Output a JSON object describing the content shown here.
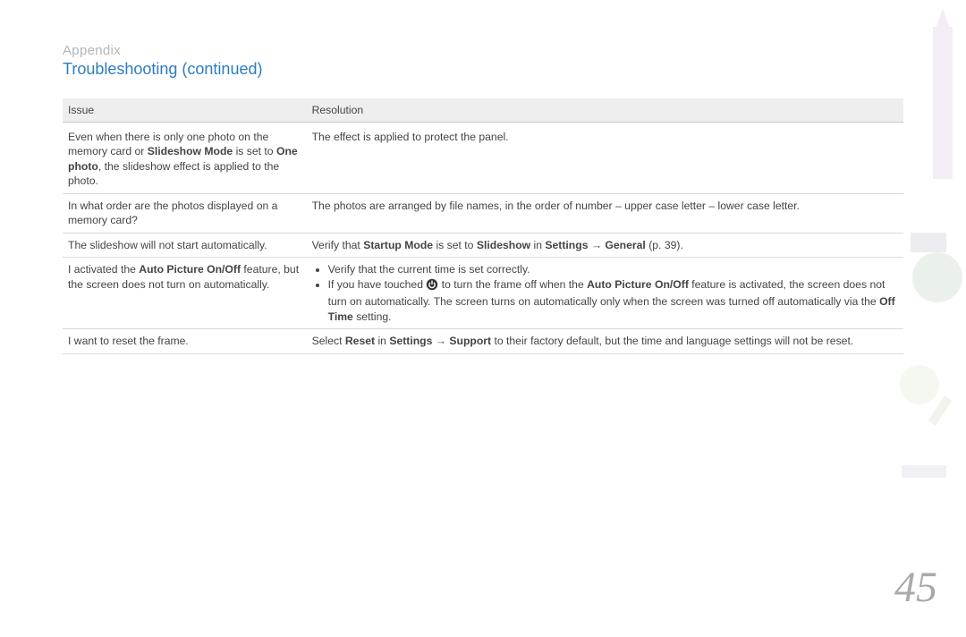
{
  "section": "Appendix",
  "title": "Troubleshooting  (continued)",
  "headers": {
    "issue": "Issue",
    "resolution": "Resolution"
  },
  "rows": [
    {
      "issue_pre": "Even when there is only one photo on the memory card or ",
      "issue_b1": "Slideshow Mode",
      "issue_mid": " is set to ",
      "issue_b2": "One photo",
      "issue_post": ", the slideshow effect is applied to the photo.",
      "res": "The effect is applied to protect the panel."
    },
    {
      "issue": "In what order are the photos displayed on a memory card?",
      "res": "The photos are arranged by file names, in the order of number – upper case letter – lower case letter."
    },
    {
      "issue": "The slideshow will not start automatically.",
      "res_pre": "Verify that ",
      "res_b1": "Startup Mode",
      "res_mid1": " is set to ",
      "res_b2": "Slideshow",
      "res_mid2": " in ",
      "res_b3": "Settings → General",
      "res_post": " (p. 39)."
    },
    {
      "issue_pre2": "I activated the ",
      "issue_b3": "Auto Picture On/Off",
      "issue_post2": " feature, but the screen does not turn on automatically.",
      "bul1": "Verify that the current time is set correctly.",
      "bul2_pre": "If you have touched ",
      "bul2_mid1": " to turn the frame off when the ",
      "bul2_b1": "Auto Picture On/Off",
      "bul2_mid2": " feature is activated, the screen does not turn on automatically. The screen turns on automatically only when the screen was turned off automatically via the ",
      "bul2_b2": "Off Time",
      "bul2_post": " setting."
    },
    {
      "issue": "I want to reset the frame.",
      "res_pre": "Select ",
      "res_b1": "Reset",
      "res_mid1": " in ",
      "res_b2": "Settings → Support",
      "res_post": " to their factory default, but the time and language settings will not be reset."
    }
  ],
  "page_number": "45"
}
